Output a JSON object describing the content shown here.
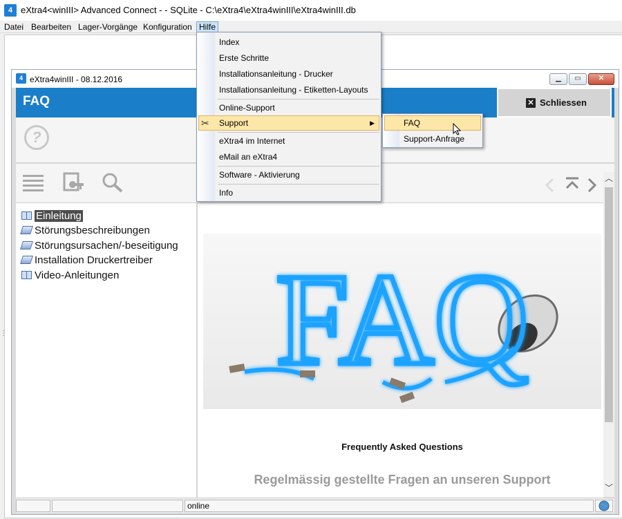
{
  "app": {
    "title": "eXtra4<winIII> Advanced Connect -  - SQLite  - C:\\eXtra4\\eXtra4winIII\\eXtra4winIII.db",
    "icon": "extra4-app-icon"
  },
  "menubar": {
    "items": [
      {
        "label": "Datei"
      },
      {
        "label": "Bearbeiten"
      },
      {
        "label": "Lager-Vorgänge"
      },
      {
        "label": "Konfiguration"
      },
      {
        "label": "Hilfe",
        "active": true
      }
    ]
  },
  "hilfe_menu": {
    "items": [
      {
        "label": "Index"
      },
      {
        "label": "Erste Schritte"
      },
      {
        "label": "Installationsanleitung - Drucker"
      },
      {
        "label": "Installationsanleitung - Etiketten-Layouts"
      },
      {
        "label": "Online-Support"
      },
      {
        "label": "Support",
        "highlighted": true,
        "has_submenu": true,
        "icon": "tools-icon"
      },
      {
        "label": "eXtra4 im Internet"
      },
      {
        "label": "eMail an eXtra4"
      },
      {
        "label": "Software - Aktivierung"
      },
      {
        "label": "Info"
      }
    ],
    "submenu_arrow": "▶"
  },
  "support_submenu": {
    "items": [
      {
        "label": "FAQ",
        "highlighted": true
      },
      {
        "label": "Support-Anfrage"
      }
    ]
  },
  "inner_window": {
    "title": "eXtra4winIII  -  08.12.2016",
    "header": "FAQ",
    "close_button": "Schliessen",
    "tree": [
      {
        "label": "Einleitung",
        "selected": true,
        "icon": "open-book-icon"
      },
      {
        "label": "Störungsbeschreibungen",
        "icon": "closed-book-icon"
      },
      {
        "label": "Störungsursachen/-beseitigung",
        "icon": "closed-book-icon"
      },
      {
        "label": "Installation Druckertreiber",
        "icon": "closed-book-icon"
      },
      {
        "label": "Video-Anleitungen",
        "icon": "open-book-icon"
      }
    ],
    "content": {
      "image_text": "FAQ",
      "caption": "Frequently Asked Questions",
      "subtitle": "Regelmässig gestellte Fragen an unseren Support"
    },
    "status": {
      "state": "online"
    }
  },
  "colors": {
    "accent_blue": "#1a7fc8",
    "menu_highlight": "#fde7a8",
    "neon_blue": "#1aa3ff"
  }
}
